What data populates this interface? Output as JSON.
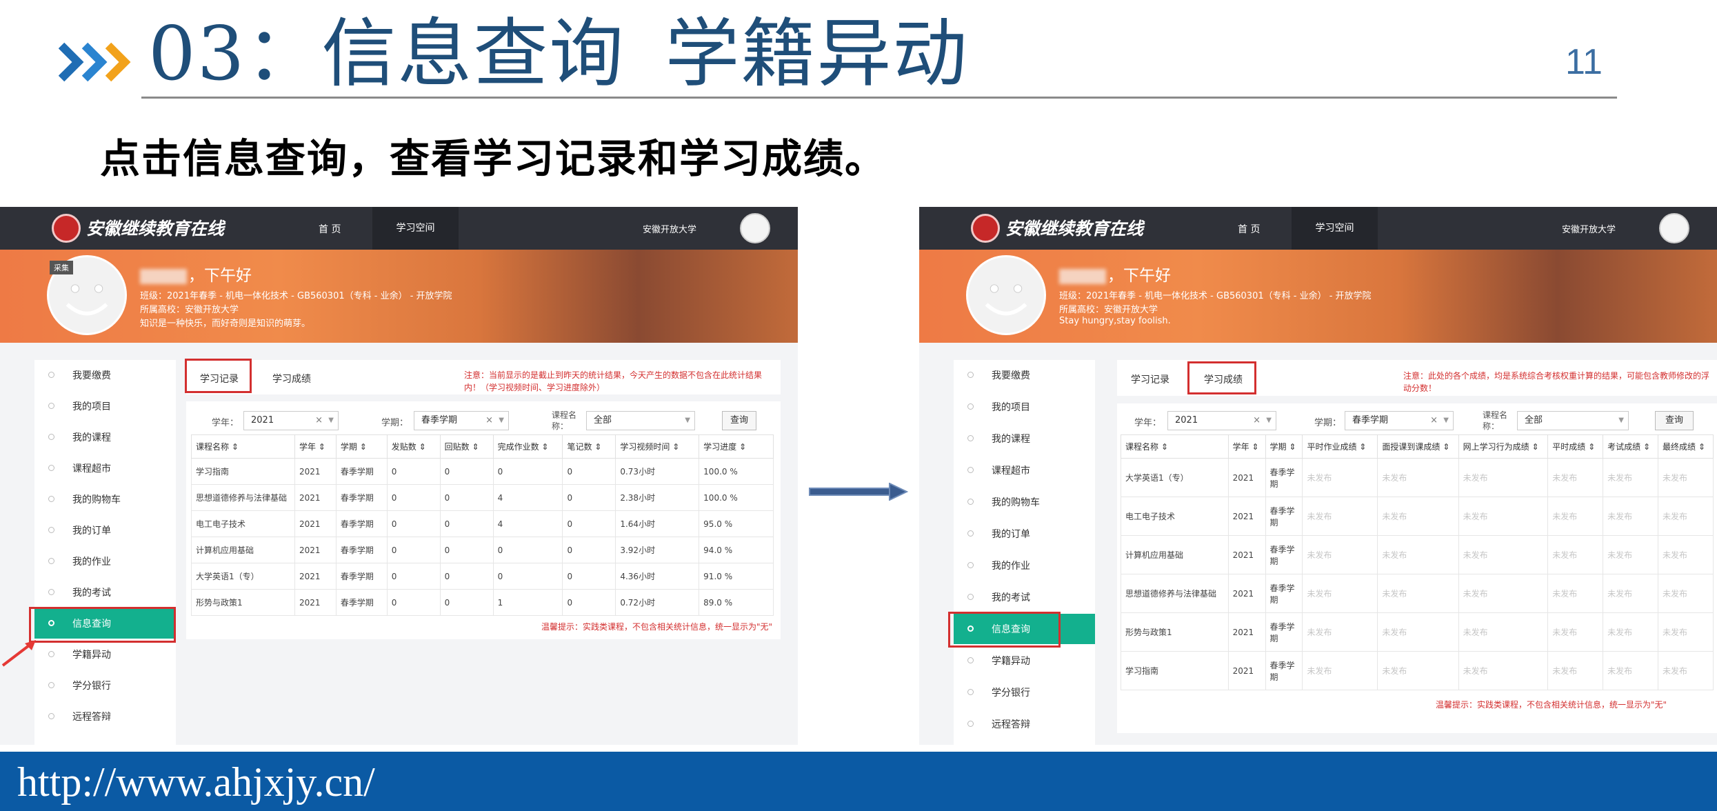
{
  "slide": {
    "title_part1": "03：信息查询",
    "title_part2": "学籍异动",
    "page_number": "11",
    "subtitle": "点击信息查询，查看学习记录和学习成绩。",
    "footer_url": "http://www.ahjxjy.cn/"
  },
  "colors": {
    "title": "#1f4e79",
    "footer_bar": "#0b5aa4",
    "nav": "#2f3138",
    "active_menu": "#13b08e",
    "highlight": "#d32f2f"
  },
  "screens": [
    {
      "site_logo": "安徽继续教育在线",
      "nav_home": "首 页",
      "nav_space": "学习空间",
      "nav_university": "安徽开放大学",
      "banner_tag": "采集",
      "greeting": "，下午好",
      "info_lines": [
        "班级：2021年春季 - 机电一体化技术 - GB560301（专科 - 业余） - 开放学院",
        "所属高校：安徽开放大学",
        "知识是一种快乐，而好奇则是知识的萌芽。"
      ],
      "sidebar": [
        "我要缴费",
        "我的项目",
        "我的课程",
        "课程超市",
        "我的购物车",
        "我的订单",
        "我的作业",
        "我的考试",
        "信息查询",
        "学籍异动",
        "学分银行",
        "远程答辩"
      ],
      "tab1": "学习记录",
      "tab2": "学习成绩",
      "notice": "注意：当前显示的是截止到昨天的统计结果，今天产生的数据不包含在此统计结果内！（学习视频时间、学习进度除外）",
      "filter_year_label": "学年：",
      "filter_year_value": "2021",
      "filter_term_label": "学期：",
      "filter_term_value": "春季学期",
      "filter_course_label": "课程名称：",
      "filter_course_value": "全部",
      "query_btn": "查询",
      "columns": [
        "课程名称 ⇕",
        "学年 ⇕",
        "学期 ⇕",
        "发贴数 ⇕",
        "回贴数 ⇕",
        "完成作业数 ⇕",
        "笔记数 ⇕",
        "学习视频时间 ⇕",
        "学习进度 ⇕"
      ],
      "rows": [
        [
          "学习指南",
          "2021",
          "春季学期",
          "0",
          "0",
          "0",
          "0",
          "0.73小时",
          "100.0 %"
        ],
        [
          "思想道德修养与法律基础",
          "2021",
          "春季学期",
          "0",
          "0",
          "4",
          "0",
          "2.38小时",
          "100.0 %"
        ],
        [
          "电工电子技术",
          "2021",
          "春季学期",
          "0",
          "0",
          "4",
          "0",
          "1.64小时",
          "95.0 %"
        ],
        [
          "计算机应用基础",
          "2021",
          "春季学期",
          "0",
          "0",
          "0",
          "0",
          "3.92小时",
          "94.0 %"
        ],
        [
          "大学英语1（专）",
          "2021",
          "春季学期",
          "0",
          "0",
          "0",
          "0",
          "4.36小时",
          "91.0 %"
        ],
        [
          "形势与政策1",
          "2021",
          "春季学期",
          "0",
          "0",
          "1",
          "0",
          "0.72小时",
          "89.0 %"
        ]
      ],
      "warm_tip": "温馨提示：实践类课程，不包含相关统计信息，统一显示为\"无\""
    },
    {
      "site_logo": "安徽继续教育在线",
      "nav_home": "首 页",
      "nav_space": "学习空间",
      "nav_university": "安徽开放大学",
      "greeting": "，下午好",
      "info_lines": [
        "班级：2021年春季 - 机电一体化技术 - GB560301（专科 - 业余） - 开放学院",
        "所属高校：安徽开放大学",
        "Stay hungry,stay foolish."
      ],
      "sidebar": [
        "我要缴费",
        "我的项目",
        "我的课程",
        "课程超市",
        "我的购物车",
        "我的订单",
        "我的作业",
        "我的考试",
        "信息查询",
        "学籍异动",
        "学分银行",
        "远程答辩"
      ],
      "tab1": "学习记录",
      "tab2": "学习成绩",
      "notice": "注意：此处的各个成绩，均是系统综合考核权重计算的结果，可能包含教师修改的浮动分数！",
      "filter_year_label": "学年：",
      "filter_year_value": "2021",
      "filter_term_label": "学期：",
      "filter_term_value": "春季学期",
      "filter_course_label": "课程名称：",
      "filter_course_value": "全部",
      "query_btn": "查询",
      "columns": [
        "课程名称 ⇕",
        "学年 ⇕",
        "学期 ⇕",
        "平时作业成绩 ⇕",
        "面授课到课成绩 ⇕",
        "网上学习行为成绩 ⇕",
        "平时成绩 ⇕",
        "考试成绩 ⇕",
        "最终成绩 ⇕"
      ],
      "rows": [
        [
          "大学英语1（专）",
          "2021",
          "春季学期",
          "未发布",
          "未发布",
          "未发布",
          "未发布",
          "未发布",
          "未发布"
        ],
        [
          "电工电子技术",
          "2021",
          "春季学期",
          "未发布",
          "未发布",
          "未发布",
          "未发布",
          "未发布",
          "未发布"
        ],
        [
          "计算机应用基础",
          "2021",
          "春季学期",
          "未发布",
          "未发布",
          "未发布",
          "未发布",
          "未发布",
          "未发布"
        ],
        [
          "思想道德修养与法律基础",
          "2021",
          "春季学期",
          "未发布",
          "未发布",
          "未发布",
          "未发布",
          "未发布",
          "未发布"
        ],
        [
          "形势与政策1",
          "2021",
          "春季学期",
          "未发布",
          "未发布",
          "未发布",
          "未发布",
          "未发布",
          "未发布"
        ],
        [
          "学习指南",
          "2021",
          "春季学期",
          "未发布",
          "未发布",
          "未发布",
          "未发布",
          "未发布",
          "未发布"
        ]
      ],
      "warm_tip": "温馨提示：实践类课程，不包含相关统计信息，统一显示为\"无\""
    }
  ]
}
